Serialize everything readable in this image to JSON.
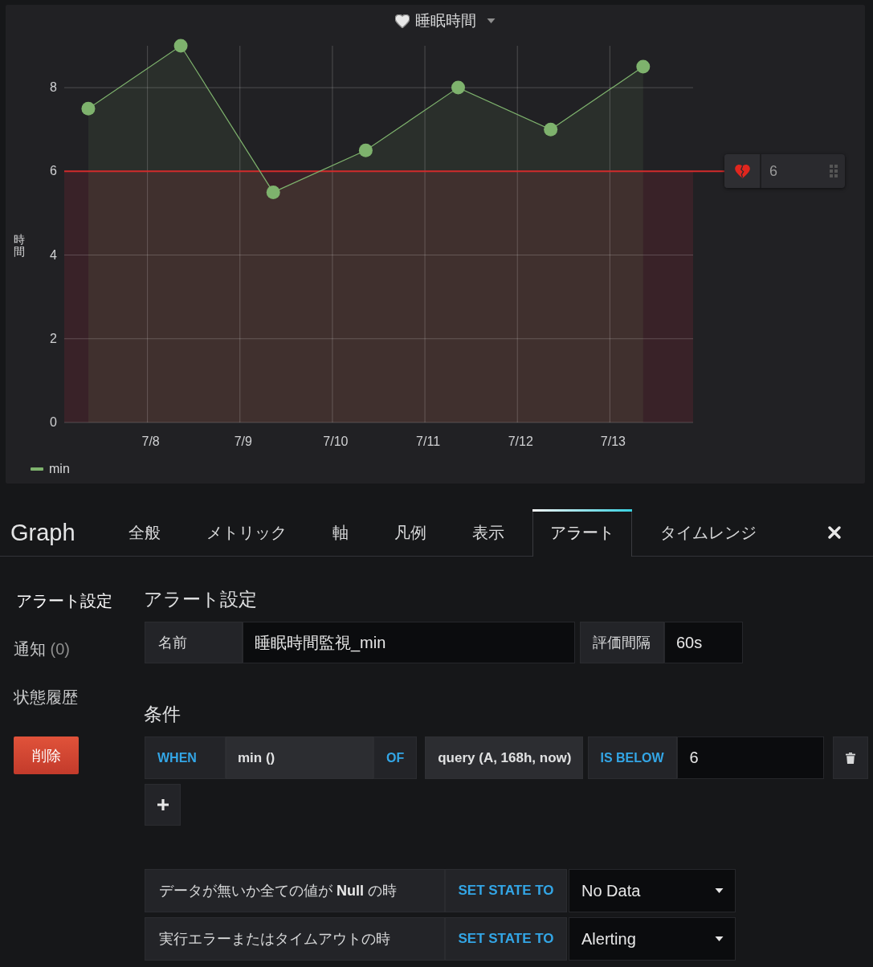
{
  "panel": {
    "title": "睡眠時間",
    "chart_data": {
      "type": "area",
      "ylabel": "時間",
      "categories": [
        null,
        "7/8",
        "7/9",
        "7/10",
        "7/11",
        "7/12",
        "7/13"
      ],
      "series": [
        {
          "name": "min",
          "color": "#7eb26d",
          "values": [
            7.5,
            9,
            5.5,
            6.5,
            8,
            7,
            8.5
          ]
        }
      ],
      "ylim": [
        0,
        9
      ],
      "yticks": [
        0,
        2,
        4,
        6,
        8
      ],
      "grid": true,
      "ref_lines": [
        {
          "axis": "y",
          "value": 6,
          "label": "6",
          "color": "#d12b2b"
        }
      ],
      "bands": [
        {
          "axis": "y",
          "from": 0,
          "to": 6,
          "color": "#e02f44"
        }
      ]
    }
  },
  "editor": {
    "title": "Graph",
    "tabs": [
      {
        "label": "全般",
        "selected": false
      },
      {
        "label": "メトリック",
        "selected": false
      },
      {
        "label": "軸",
        "selected": false
      },
      {
        "label": "凡例",
        "selected": false
      },
      {
        "label": "表示",
        "selected": false
      },
      {
        "label": "アラート",
        "selected": true
      },
      {
        "label": "タイムレンジ",
        "selected": false
      }
    ]
  },
  "sidebar": {
    "items": [
      {
        "label": "アラート設定",
        "selected": true
      },
      {
        "label": "通知",
        "count": "(0)",
        "selected": false
      },
      {
        "label": "状態履歴",
        "selected": false
      }
    ],
    "delete_button": "削除"
  },
  "alert_config": {
    "heading": "アラート設定",
    "fields": [
      {
        "label": "名前",
        "value": "睡眠時間監視_min"
      },
      {
        "label": "評価間隔",
        "value": "60s"
      }
    ]
  },
  "conditions": {
    "heading": "条件",
    "rows": [
      {
        "when": "WHEN",
        "reducer": "min ()",
        "of": "OF",
        "query": "query (A, 168h, now)",
        "evaluator": "IS BELOW",
        "value": "6"
      }
    ]
  },
  "no_data_handlers": [
    {
      "label": "データが無いか全ての値が **Null** の時",
      "action": "SET STATE TO",
      "value": "No Data"
    },
    {
      "label": "実行エラーまたはタイムアウトの時",
      "action": "SET STATE TO",
      "value": "Alerting"
    }
  ]
}
